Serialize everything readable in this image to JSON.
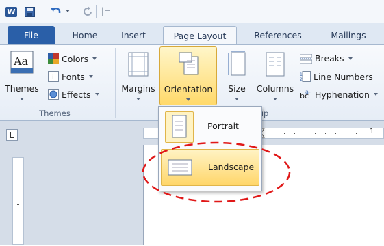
{
  "quick_access": {
    "app_icon": "word-logo-icon",
    "app_letter": "W",
    "customize_glyph": "|="
  },
  "tabs": [
    {
      "label": "File"
    },
    {
      "label": "Home"
    },
    {
      "label": "Insert"
    },
    {
      "label": "Page Layout"
    },
    {
      "label": "References"
    },
    {
      "label": "Mailings"
    }
  ],
  "ribbon": {
    "themes_group": {
      "label": "Themes",
      "themes_button": "Themes",
      "colors": "Colors",
      "fonts": "Fonts",
      "effects": "Effects",
      "themes_icon_text": "Aa"
    },
    "page_setup": {
      "margins": "Margins",
      "orientation": "Orientation",
      "size": "Size",
      "columns": "Columns",
      "breaks": "Breaks",
      "line_numbers": "Line Numbers",
      "hyphenation": "Hyphenation",
      "group_label_visible": "up"
    }
  },
  "orientation_menu": {
    "items": [
      {
        "label": "Portrait"
      },
      {
        "label": "Landscape"
      }
    ]
  },
  "ruler": {
    "tick_number": "1"
  },
  "colors": {
    "file_tab": "#2a5fa8",
    "highlight": "#ffd96b",
    "annotation": "#e01818"
  }
}
